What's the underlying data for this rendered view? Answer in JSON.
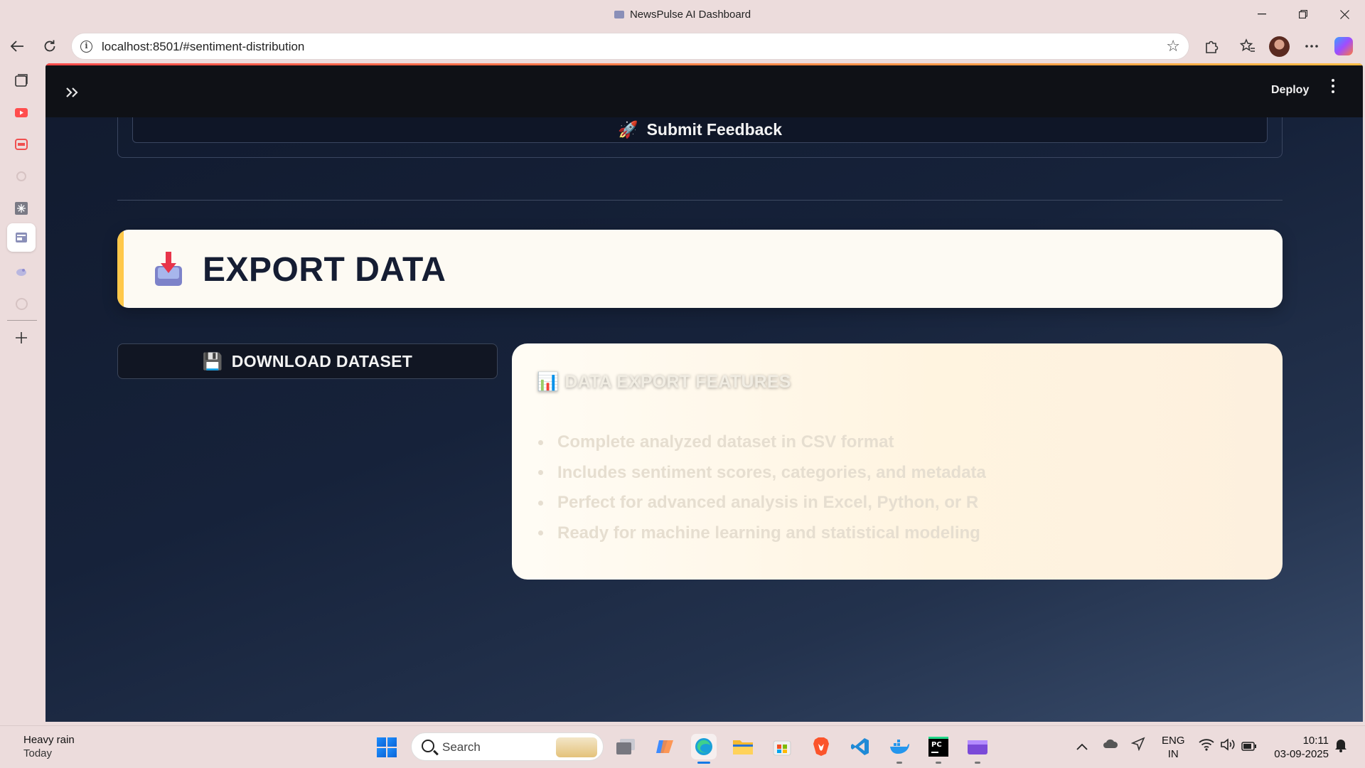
{
  "browser": {
    "title": "NewsPulse AI Dashboard",
    "url": "localhost:8501/#sentiment-distribution"
  },
  "app": {
    "header": {
      "deploy_label": "Deploy"
    },
    "feedback_button": {
      "emoji": "🚀",
      "label": "Submit Feedback"
    },
    "export_section": {
      "title": "EXPORT DATA"
    },
    "download_button": {
      "emoji": "💾",
      "label": "DOWNLOAD DATASET"
    },
    "features": {
      "emoji": "📊",
      "title": "DATA EXPORT FEATURES",
      "items": [
        "Complete analyzed dataset in CSV format",
        "Includes sentiment scores, categories, and metadata",
        "Perfect for advanced analysis in Excel, Python, or R",
        "Ready for machine learning and statistical modeling"
      ]
    }
  },
  "taskbar": {
    "weather": {
      "condition": "Heavy rain",
      "day": "Today"
    },
    "search_label": "Search",
    "language": {
      "line1": "ENG",
      "line2": "IN"
    },
    "clock": {
      "time": "10:11",
      "date": "03-09-2025"
    }
  },
  "colors": {
    "accent_bar": "#ffc84a",
    "header_gradient_start": "#ff4b4b",
    "header_gradient_end": "#ffbd45",
    "app_background": "#16223a"
  }
}
